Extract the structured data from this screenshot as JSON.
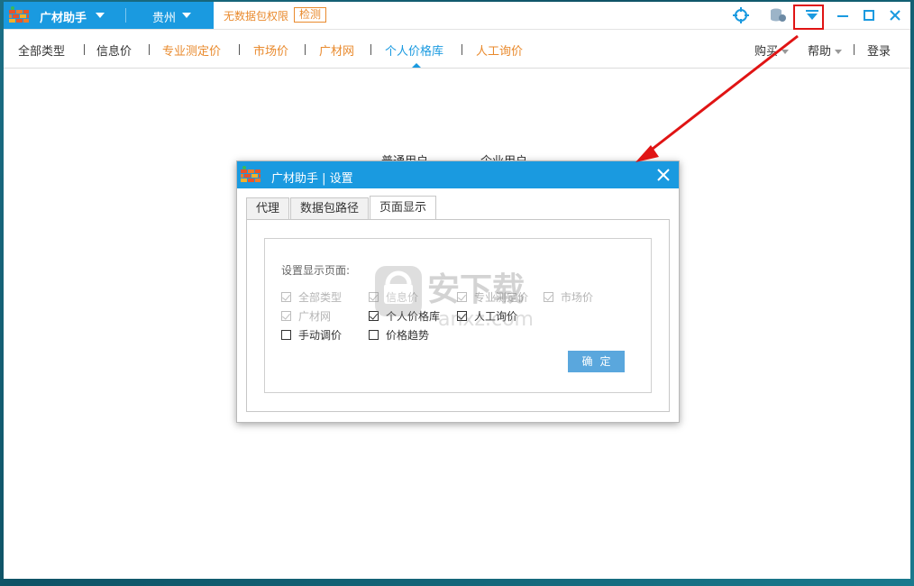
{
  "titlebar": {
    "app_name": "广材助手",
    "city": "贵州",
    "warning": "无数据包权限",
    "detect_label": "检测"
  },
  "nav": {
    "items": [
      {
        "label": "全部类型",
        "style": "dark"
      },
      {
        "label": "信息价",
        "style": "dark"
      },
      {
        "label": "专业测定价",
        "style": "orange"
      },
      {
        "label": "市场价",
        "style": "orange"
      },
      {
        "label": "广材网",
        "style": "orange"
      },
      {
        "label": "个人价格库",
        "style": "active"
      },
      {
        "label": "人工询价",
        "style": "orange"
      }
    ],
    "buy": "购买",
    "help": "帮助",
    "login": "登录"
  },
  "content": {
    "user_normal": "普通用户",
    "user_enterprise": "企业用户"
  },
  "dialog": {
    "title": "广材助手 | 设置",
    "tabs": [
      "代理",
      "数据包路径",
      "页面显示"
    ],
    "active_tab": "页面显示",
    "group_label": "设置显示页面:",
    "checkboxes": [
      {
        "label": "全部类型",
        "checked": true,
        "disabled": true
      },
      {
        "label": "信息价",
        "checked": true,
        "disabled": true
      },
      {
        "label": "专业测定价",
        "checked": true,
        "disabled": true
      },
      {
        "label": "市场价",
        "checked": true,
        "disabled": true
      },
      {
        "label": "广材网",
        "checked": true,
        "disabled": true
      },
      {
        "label": "个人价格库",
        "checked": true,
        "disabled": false
      },
      {
        "label": "人工询价",
        "checked": true,
        "disabled": false
      },
      {
        "label": "手动调价",
        "checked": false,
        "disabled": false
      },
      {
        "label": "价格趋势",
        "checked": false,
        "disabled": false
      }
    ],
    "ok_label": "确定"
  },
  "watermark": {
    "text": "安下载",
    "url": "anxz.com"
  },
  "colors": {
    "brand_blue": "#1a9ae0",
    "orange": "#e98a2d",
    "highlight_red": "#e01414"
  }
}
